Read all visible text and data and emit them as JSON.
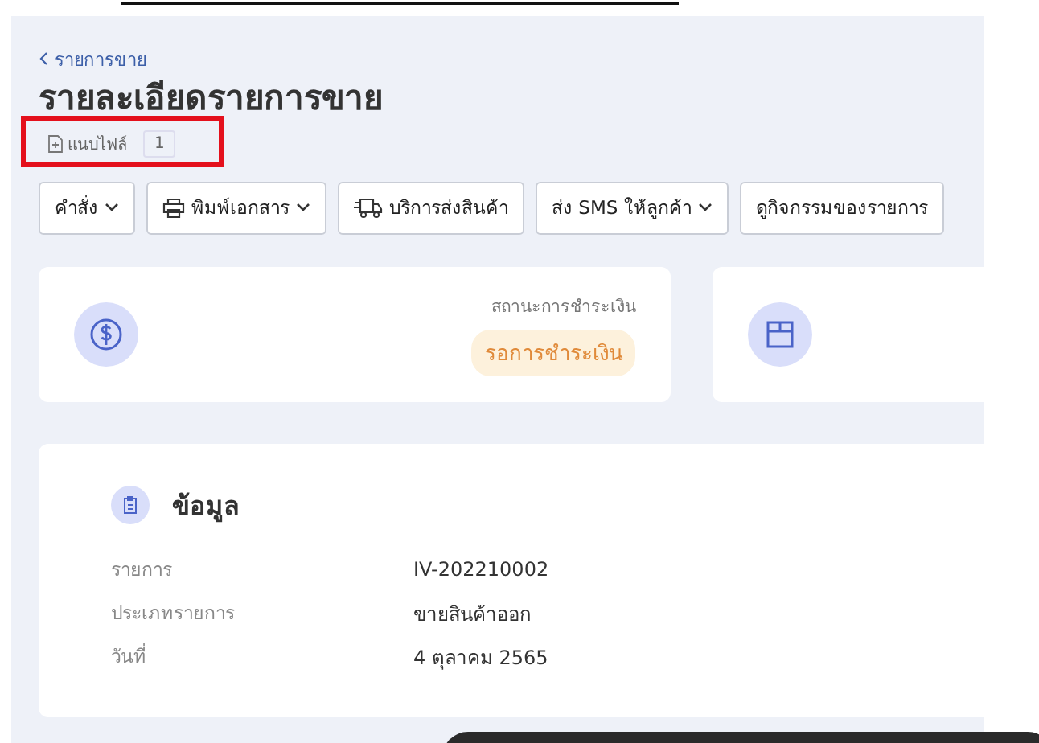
{
  "breadcrumb": {
    "label": "รายการขาย"
  },
  "title": "รายละเอียดรายการขาย",
  "attachment": {
    "label": "แนบไฟล์",
    "count": "1"
  },
  "actions": [
    {
      "label": "คำสั่ง",
      "dropdown": true
    },
    {
      "label": "พิมพ์เอกสาร",
      "dropdown": true
    },
    {
      "label": "บริการส่งสินค้า",
      "dropdown": false
    },
    {
      "label": "ส่ง SMS ให้ลูกค้า",
      "dropdown": true
    },
    {
      "label": "ดูกิจกรรมของรายการ",
      "dropdown": false
    }
  ],
  "payment_card": {
    "label": "สถานะการชำระเงิน",
    "status": "รอการชำระเงิน"
  },
  "info": {
    "title": "ข้อมูล",
    "rows": [
      {
        "label": "รายการ",
        "value": "IV-202210002"
      },
      {
        "label": "ประเภทรายการ",
        "value": "ขายสินค้าออก"
      },
      {
        "label": "วันที่",
        "value": "4 ตุลาคม 2565"
      }
    ]
  }
}
